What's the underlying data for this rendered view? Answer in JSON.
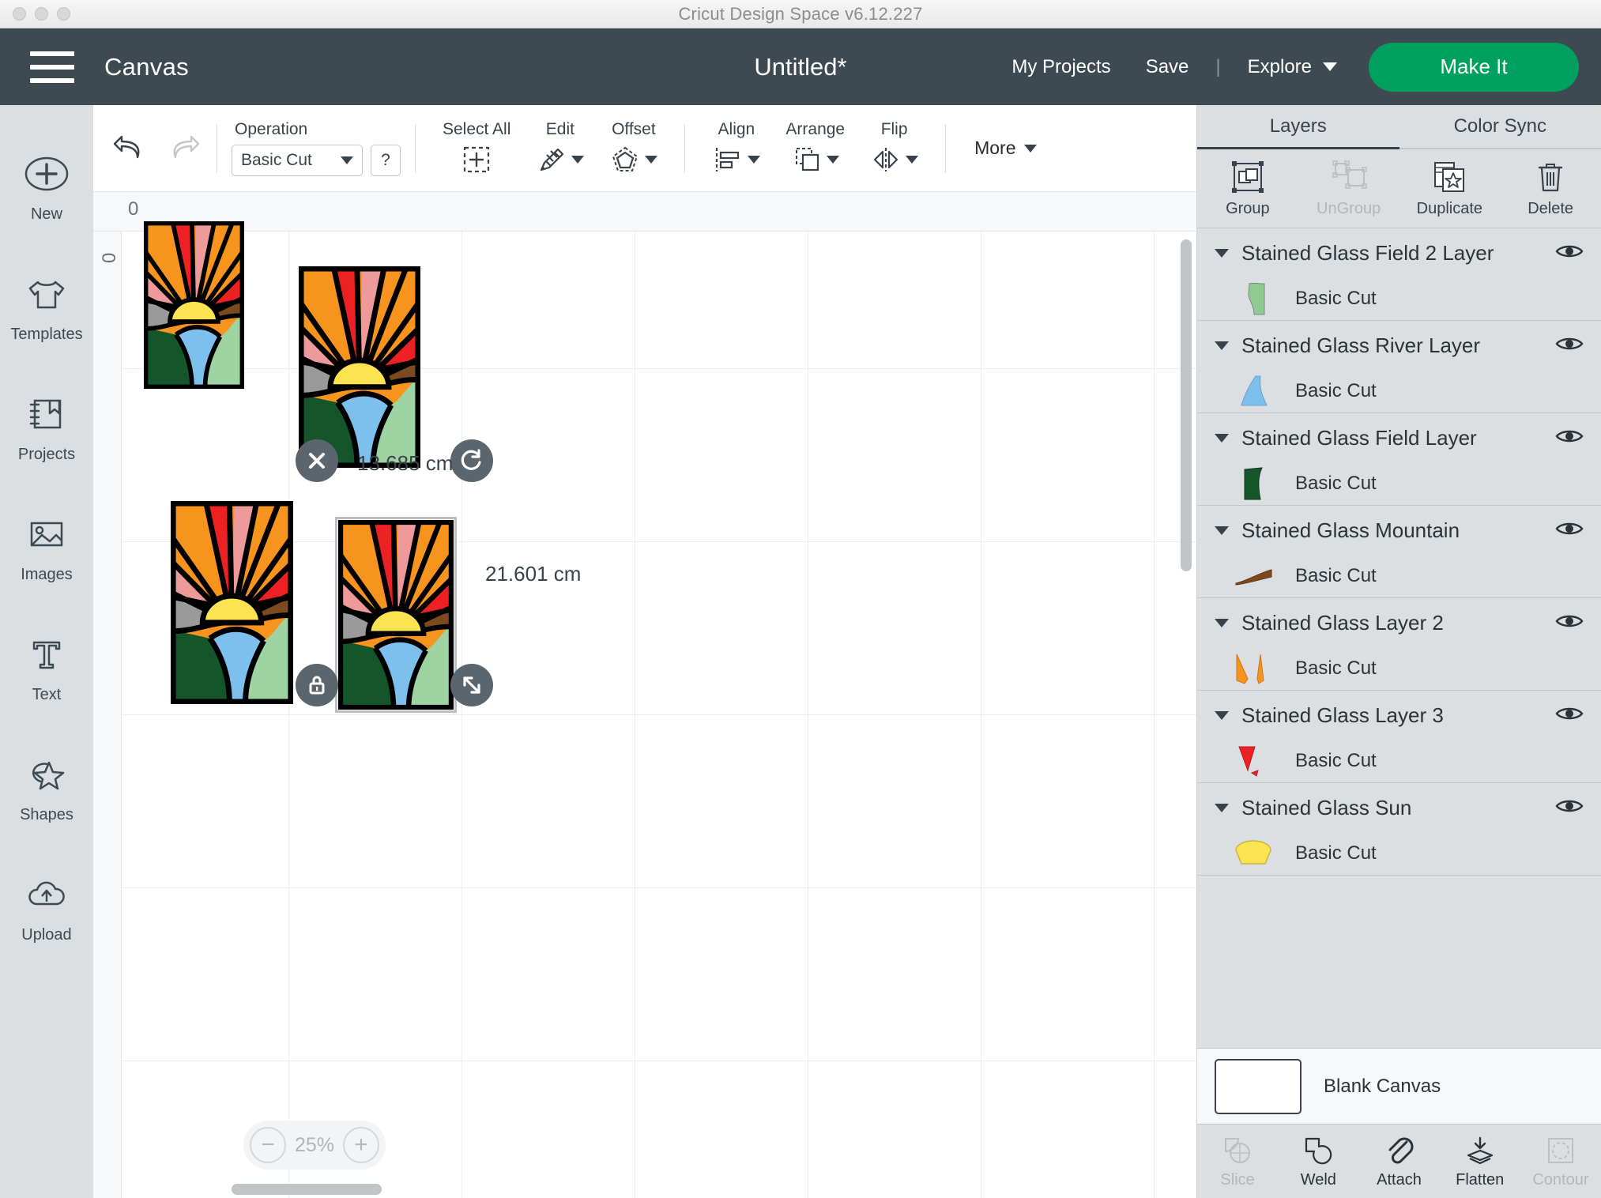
{
  "os": {
    "title": "Cricut Design Space  v6.12.227"
  },
  "header": {
    "menu_icon": "hamburger-icon",
    "canvas_label": "Canvas",
    "doc_title": "Untitled*",
    "my_projects": "My Projects",
    "save": "Save",
    "separator": "|",
    "explore": "Explore",
    "make_it": "Make It",
    "accent_green": "#00a160",
    "bar_color": "#3e4a52"
  },
  "rail": {
    "items": [
      {
        "label": "New",
        "icon": "plus-circle-icon"
      },
      {
        "label": "Templates",
        "icon": "tshirt-icon"
      },
      {
        "label": "Projects",
        "icon": "book-bookmark-icon"
      },
      {
        "label": "Images",
        "icon": "picture-icon"
      },
      {
        "label": "Text",
        "icon": "text-t-icon"
      },
      {
        "label": "Shapes",
        "icon": "shapes-star-icon"
      },
      {
        "label": "Upload",
        "icon": "cloud-upload-icon"
      }
    ]
  },
  "toolbar": {
    "undo": "undo-icon",
    "redo": "redo-icon",
    "operation_label": "Operation",
    "operation_value": "Basic Cut",
    "operation_help": "?",
    "select_all": "Select All",
    "edit": "Edit",
    "offset": "Offset",
    "align": "Align",
    "arrange": "Arrange",
    "flip": "Flip",
    "more": "More"
  },
  "canvas": {
    "ruler_top_origin": "0",
    "ruler_left_origin": "0",
    "zoom_level": "25%",
    "zoom_out": "−",
    "zoom_in": "+",
    "selection": {
      "width_label": "13.685 cm",
      "height_label": "21.601 cm",
      "delete_handle": "close-icon",
      "rotate_handle": "rotate-icon",
      "lock_handle": "lock-icon",
      "resize_handle": "resize-icon"
    },
    "artwork_colors": {
      "outline": "#000000",
      "red": "#ed2024",
      "pink": "#ef9a9a",
      "orange": "#f7941e",
      "yellow": "#fbe352",
      "grey": "#9a9a9a",
      "brown": "#7b4a1e",
      "dark_green": "#14562a",
      "light_green": "#9ed3a2",
      "blue": "#7dc0ee"
    },
    "artwork_instances": [
      {
        "name": "stained-glass-art-1",
        "selected": false
      },
      {
        "name": "stained-glass-art-2",
        "selected": false
      },
      {
        "name": "stained-glass-art-3",
        "selected": false
      },
      {
        "name": "stained-glass-art-4",
        "selected": true
      }
    ]
  },
  "panel": {
    "tabs": [
      {
        "label": "Layers",
        "active": true
      },
      {
        "label": "Color Sync",
        "active": false
      }
    ],
    "ops": [
      {
        "label": "Group",
        "icon": "group-icon",
        "disabled": false
      },
      {
        "label": "UnGroup",
        "icon": "ungroup-icon",
        "disabled": true
      },
      {
        "label": "Duplicate",
        "icon": "duplicate-icon",
        "disabled": false
      },
      {
        "label": "Delete",
        "icon": "trash-icon",
        "disabled": false
      }
    ],
    "layers": [
      {
        "title": "Stained Glass Field 2 Layer",
        "sublabel": "Basic Cut",
        "swatch": "field2-shape",
        "color": "#90ca93"
      },
      {
        "title": "Stained Glass River Layer",
        "sublabel": "Basic Cut",
        "swatch": "river-shape",
        "color": "#7dc0ee"
      },
      {
        "title": "Stained Glass Field Layer",
        "sublabel": "Basic Cut",
        "swatch": "field-shape",
        "color": "#14562a"
      },
      {
        "title": "Stained Glass Mountain",
        "sublabel": "Basic Cut",
        "swatch": "mountain-shape",
        "color": "#7b4a1e"
      },
      {
        "title": "Stained Glass Layer 2",
        "sublabel": "Basic Cut",
        "swatch": "ray2-shape",
        "color": "#f7941e"
      },
      {
        "title": "Stained Glass Layer 3",
        "sublabel": "Basic Cut",
        "swatch": "ray3-shape",
        "color": "#ed2024"
      },
      {
        "title": "Stained Glass Sun",
        "sublabel": "Basic Cut",
        "swatch": "sun-shape",
        "color": "#fbe352"
      }
    ],
    "canvas_row": {
      "label": "Blank Canvas"
    },
    "bottom_tools": [
      {
        "label": "Slice",
        "icon": "slice-icon",
        "disabled": true
      },
      {
        "label": "Weld",
        "icon": "weld-icon",
        "disabled": false
      },
      {
        "label": "Attach",
        "icon": "attach-paperclip-icon",
        "disabled": false
      },
      {
        "label": "Flatten",
        "icon": "flatten-icon",
        "disabled": false
      },
      {
        "label": "Contour",
        "icon": "contour-icon",
        "disabled": true
      }
    ]
  }
}
